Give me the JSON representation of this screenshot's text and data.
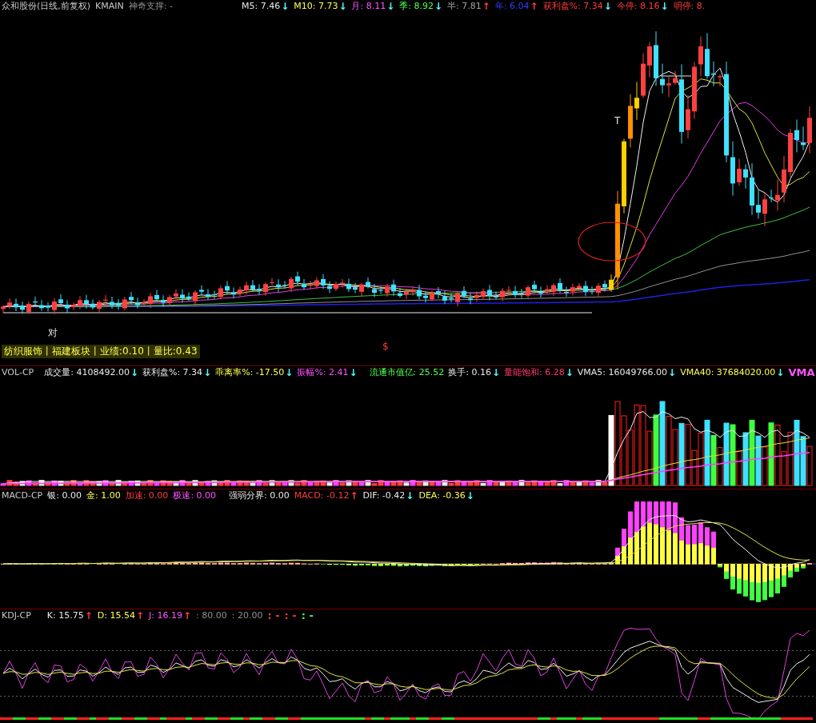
{
  "main": {
    "title": "众和股份(日线,前复权)",
    "formula": "KMAIN",
    "support": "神奇支撑: -",
    "legend": [
      {
        "text": "M5: 7.46",
        "color": "#e8e8e8",
        "arrow": "↓",
        "rising": false
      },
      {
        "text": "M10: 7.73",
        "color": "#ffff54",
        "arrow": "↓",
        "rising": false
      },
      {
        "text": "月: 8.11",
        "color": "#ff54ff",
        "arrow": "↓",
        "rising": false
      },
      {
        "text": "季: 8.92",
        "color": "#54ff54",
        "arrow": "↓",
        "rising": false
      },
      {
        "text": "半: 7.81",
        "color": "#a0a0a0",
        "arrow": "↑",
        "rising": true
      },
      {
        "text": "年: 6.04",
        "color": "#3c3cff",
        "arrow": "↑",
        "rising": true
      },
      {
        "text": "获利盘%: 7.34",
        "color": "#ff3c3c",
        "arrow": "↓",
        "rising": false
      },
      {
        "text": "今停: 8.16",
        "color": "#ff3c3c",
        "arrow": "↓",
        "rising": false
      },
      {
        "text": "明停: 8.",
        "color": "#ff3c3c"
      }
    ],
    "chart_labels": [
      "对",
      "T",
      "$"
    ],
    "banner": "纺织服饰丨福建板块丨业绩:0.10丨量比:0.43"
  },
  "volume": {
    "name": "VOL-CP",
    "legend": [
      {
        "text": "成交量: 4108492.00",
        "color": "#e8e8e8",
        "arrow": "↓",
        "rising": false
      },
      {
        "text": "获利盘%: 7.34",
        "color": "#e8e8e8",
        "arrow": "↓",
        "rising": false
      },
      {
        "text": "乖离率%: -17.50",
        "color": "#ffff54",
        "arrow": "↓",
        "rising": false
      },
      {
        "text": "振幅%: 2.41",
        "color": "#ff54ff",
        "arrow": "↓",
        "rising": false
      },
      {
        "text": "流通市值亿: 25.52",
        "color": "#54ff54"
      },
      {
        "text": "换手: 0.16",
        "color": "#e8e8e8",
        "arrow": "↓",
        "rising": false
      },
      {
        "text": "量能饱和: 6.28",
        "color": "#ff3c6c",
        "arrow": "↓",
        "rising": false
      },
      {
        "text": "VMA5: 16049766.00",
        "color": "#e8e8e8",
        "arrow": "↓",
        "rising": false
      },
      {
        "text": "VMA40: 37684020.00",
        "color": "#ffff54",
        "arrow": "↓",
        "rising": false
      },
      {
        "text": "VMA",
        "color": "#ff54ff"
      }
    ]
  },
  "macd": {
    "name": "MACD-CP",
    "legend": [
      {
        "text": "银: 0.00",
        "color": "#e8e8e8"
      },
      {
        "text": "金: 1.00",
        "color": "#ffff54"
      },
      {
        "text": "加速: 0.00",
        "color": "#ff3c3c"
      },
      {
        "text": "极速: 0.00",
        "color": "#ff54ff"
      },
      {
        "text": "强弱分界: 0.00",
        "color": "#e8e8e8"
      },
      {
        "text": "MACD: -0.12",
        "color": "#ff3c3c",
        "arrow": "↑",
        "rising": true
      },
      {
        "text": "DIF: -0.42",
        "color": "#e8e8e8",
        "arrow": "↓",
        "rising": false
      },
      {
        "text": "DEA: -0.36",
        "color": "#ffff54",
        "arrow": "↓",
        "rising": false
      }
    ]
  },
  "kdj": {
    "name": "KDJ-CP",
    "legend": [
      {
        "text": "K: 15.75",
        "color": "#e8e8e8",
        "arrow": "↑",
        "rising": true
      },
      {
        "text": "D: 15.54",
        "color": "#ffff54",
        "arrow": "↑",
        "rising": true
      },
      {
        "text": "J: 16.19",
        "color": "#ff54ff",
        "arrow": "↑",
        "rising": true
      },
      {
        "text": ": 80.00",
        "color": "#909090"
      },
      {
        "text": ": 20.00",
        "color": "#909090"
      },
      {
        "text": ": -",
        "color": "#ff3c3c"
      },
      {
        "text": ": -",
        "color": "#ff3c3c"
      },
      {
        "text": ": -",
        "color": "#54ff54"
      }
    ]
  }
}
